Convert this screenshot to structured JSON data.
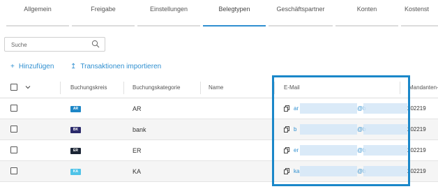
{
  "tabs": [
    {
      "label": "Allgemein"
    },
    {
      "label": "Freigabe"
    },
    {
      "label": "Einstellungen"
    },
    {
      "label": "Belegtypen"
    },
    {
      "label": "Geschäftspartner"
    },
    {
      "label": "Konten"
    },
    {
      "label": "Kostenst"
    }
  ],
  "active_tab": "Belegtypen",
  "search": {
    "placeholder": "Suche"
  },
  "actions": {
    "add_label": "Hinzufügen",
    "import_label": "Transaktionen importieren"
  },
  "table": {
    "headers": {
      "buchungskreis": "Buchungskreis",
      "buchungskategorie": "Buchungskategorie",
      "name": "Name",
      "email": "E-Mail",
      "mandant": "Mandanten-"
    },
    "rows": [
      {
        "badge": "AR",
        "badge_color": "#1d86c6",
        "category": "AR",
        "email_start": "ar",
        "email_mid": "@b",
        "mandant": "202219"
      },
      {
        "badge": "BK",
        "badge_color": "#2b2a6b",
        "category": "bank",
        "email_start": "b",
        "email_mid": "@b",
        "mandant": "202219"
      },
      {
        "badge": "ER",
        "badge_color": "#1b2535",
        "category": "ER",
        "email_start": "er",
        "email_mid": "@b",
        "mandant": "202219"
      },
      {
        "badge": "KA",
        "badge_color": "#4fc3e8",
        "category": "KA",
        "email_start": "ka",
        "email_mid": "@b",
        "mandant": "202219"
      }
    ]
  },
  "colors": {
    "accent": "#2f8fd0",
    "highlight_border": "#1a87c9",
    "row_alt": "#f5f5f5"
  }
}
